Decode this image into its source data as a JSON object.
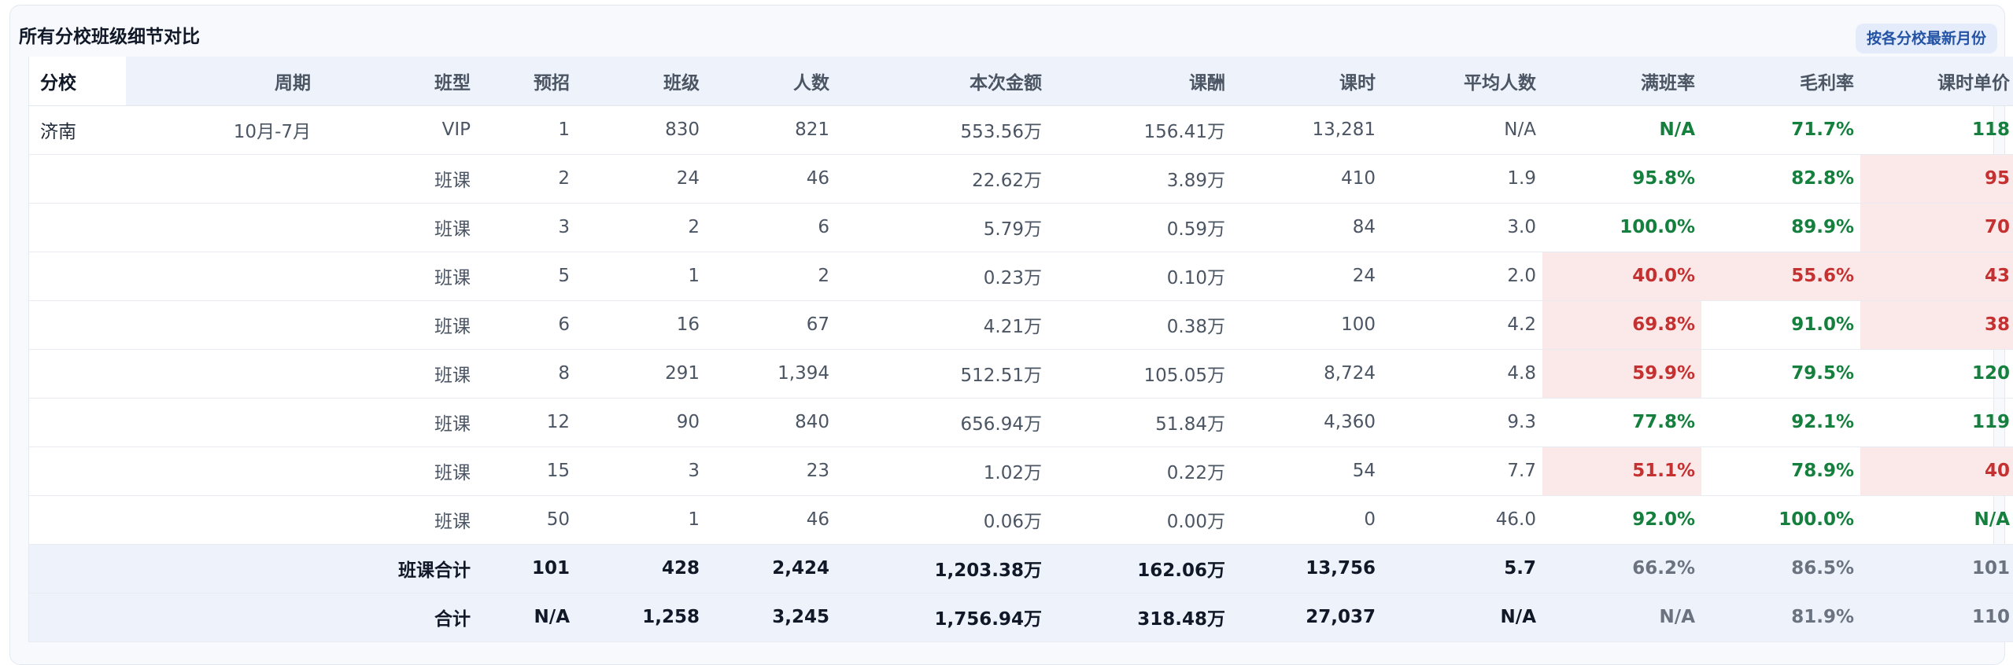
{
  "title": "所有分校班级细节对比",
  "scope_button": "按各分校最新月份",
  "columns": [
    "分校",
    "周期",
    "班型",
    "预招",
    "班级",
    "人数",
    "本次金额",
    "课酬",
    "课时",
    "平均人数",
    "满班率",
    "毛利率",
    "课时单价"
  ],
  "rows": [
    {
      "branch": "济南",
      "period": "10月-7月",
      "type": "VIP",
      "pre": "1",
      "classes": "830",
      "people": "821",
      "amount": "553.56万",
      "fee": "156.41万",
      "hours": "13,281",
      "avg": "N/A",
      "full": "N/A",
      "margin": "71.7%",
      "unit": "118"
    },
    {
      "branch": "",
      "period": "",
      "type": "班课",
      "pre": "2",
      "classes": "24",
      "people": "46",
      "amount": "22.62万",
      "fee": "3.89万",
      "hours": "410",
      "avg": "1.9",
      "full": "95.8%",
      "margin": "82.8%",
      "unit": "95"
    },
    {
      "branch": "",
      "period": "",
      "type": "班课",
      "pre": "3",
      "classes": "2",
      "people": "6",
      "amount": "5.79万",
      "fee": "0.59万",
      "hours": "84",
      "avg": "3.0",
      "full": "100.0%",
      "margin": "89.9%",
      "unit": "70"
    },
    {
      "branch": "",
      "period": "",
      "type": "班课",
      "pre": "5",
      "classes": "1",
      "people": "2",
      "amount": "0.23万",
      "fee": "0.10万",
      "hours": "24",
      "avg": "2.0",
      "full": "40.0%",
      "margin": "55.6%",
      "unit": "43"
    },
    {
      "branch": "",
      "period": "",
      "type": "班课",
      "pre": "6",
      "classes": "16",
      "people": "67",
      "amount": "4.21万",
      "fee": "0.38万",
      "hours": "100",
      "avg": "4.2",
      "full": "69.8%",
      "margin": "91.0%",
      "unit": "38"
    },
    {
      "branch": "",
      "period": "",
      "type": "班课",
      "pre": "8",
      "classes": "291",
      "people": "1,394",
      "amount": "512.51万",
      "fee": "105.05万",
      "hours": "8,724",
      "avg": "4.8",
      "full": "59.9%",
      "margin": "79.5%",
      "unit": "120"
    },
    {
      "branch": "",
      "period": "",
      "type": "班课",
      "pre": "12",
      "classes": "90",
      "people": "840",
      "amount": "656.94万",
      "fee": "51.84万",
      "hours": "4,360",
      "avg": "9.3",
      "full": "77.8%",
      "margin": "92.1%",
      "unit": "119"
    },
    {
      "branch": "",
      "period": "",
      "type": "班课",
      "pre": "15",
      "classes": "3",
      "people": "23",
      "amount": "1.02万",
      "fee": "0.22万",
      "hours": "54",
      "avg": "7.7",
      "full": "51.1%",
      "margin": "78.9%",
      "unit": "40"
    },
    {
      "branch": "",
      "period": "",
      "type": "班课",
      "pre": "50",
      "classes": "1",
      "people": "46",
      "amount": "0.06万",
      "fee": "0.00万",
      "hours": "0",
      "avg": "46.0",
      "full": "92.0%",
      "margin": "100.0%",
      "unit": "N/A"
    }
  ],
  "subtotal": {
    "label": "班课合计",
    "pre": "101",
    "classes": "428",
    "people": "2,424",
    "amount": "1,203.38万",
    "fee": "162.06万",
    "hours": "13,756",
    "avg": "5.7",
    "full": "66.2%",
    "margin": "86.5%",
    "unit": "101"
  },
  "total": {
    "label": "合计",
    "pre": "N/A",
    "classes": "1,258",
    "people": "3,245",
    "amount": "1,756.94万",
    "fee": "318.48万",
    "hours": "27,037",
    "avg": "N/A",
    "full": "N/A",
    "margin": "81.9%",
    "unit": "110"
  },
  "colors": {
    "good": "#15803d",
    "bad": "#c53030",
    "bad_bg": "#fbe9e9",
    "header_bg": "#eef3fb",
    "accent": "#2453a6"
  }
}
